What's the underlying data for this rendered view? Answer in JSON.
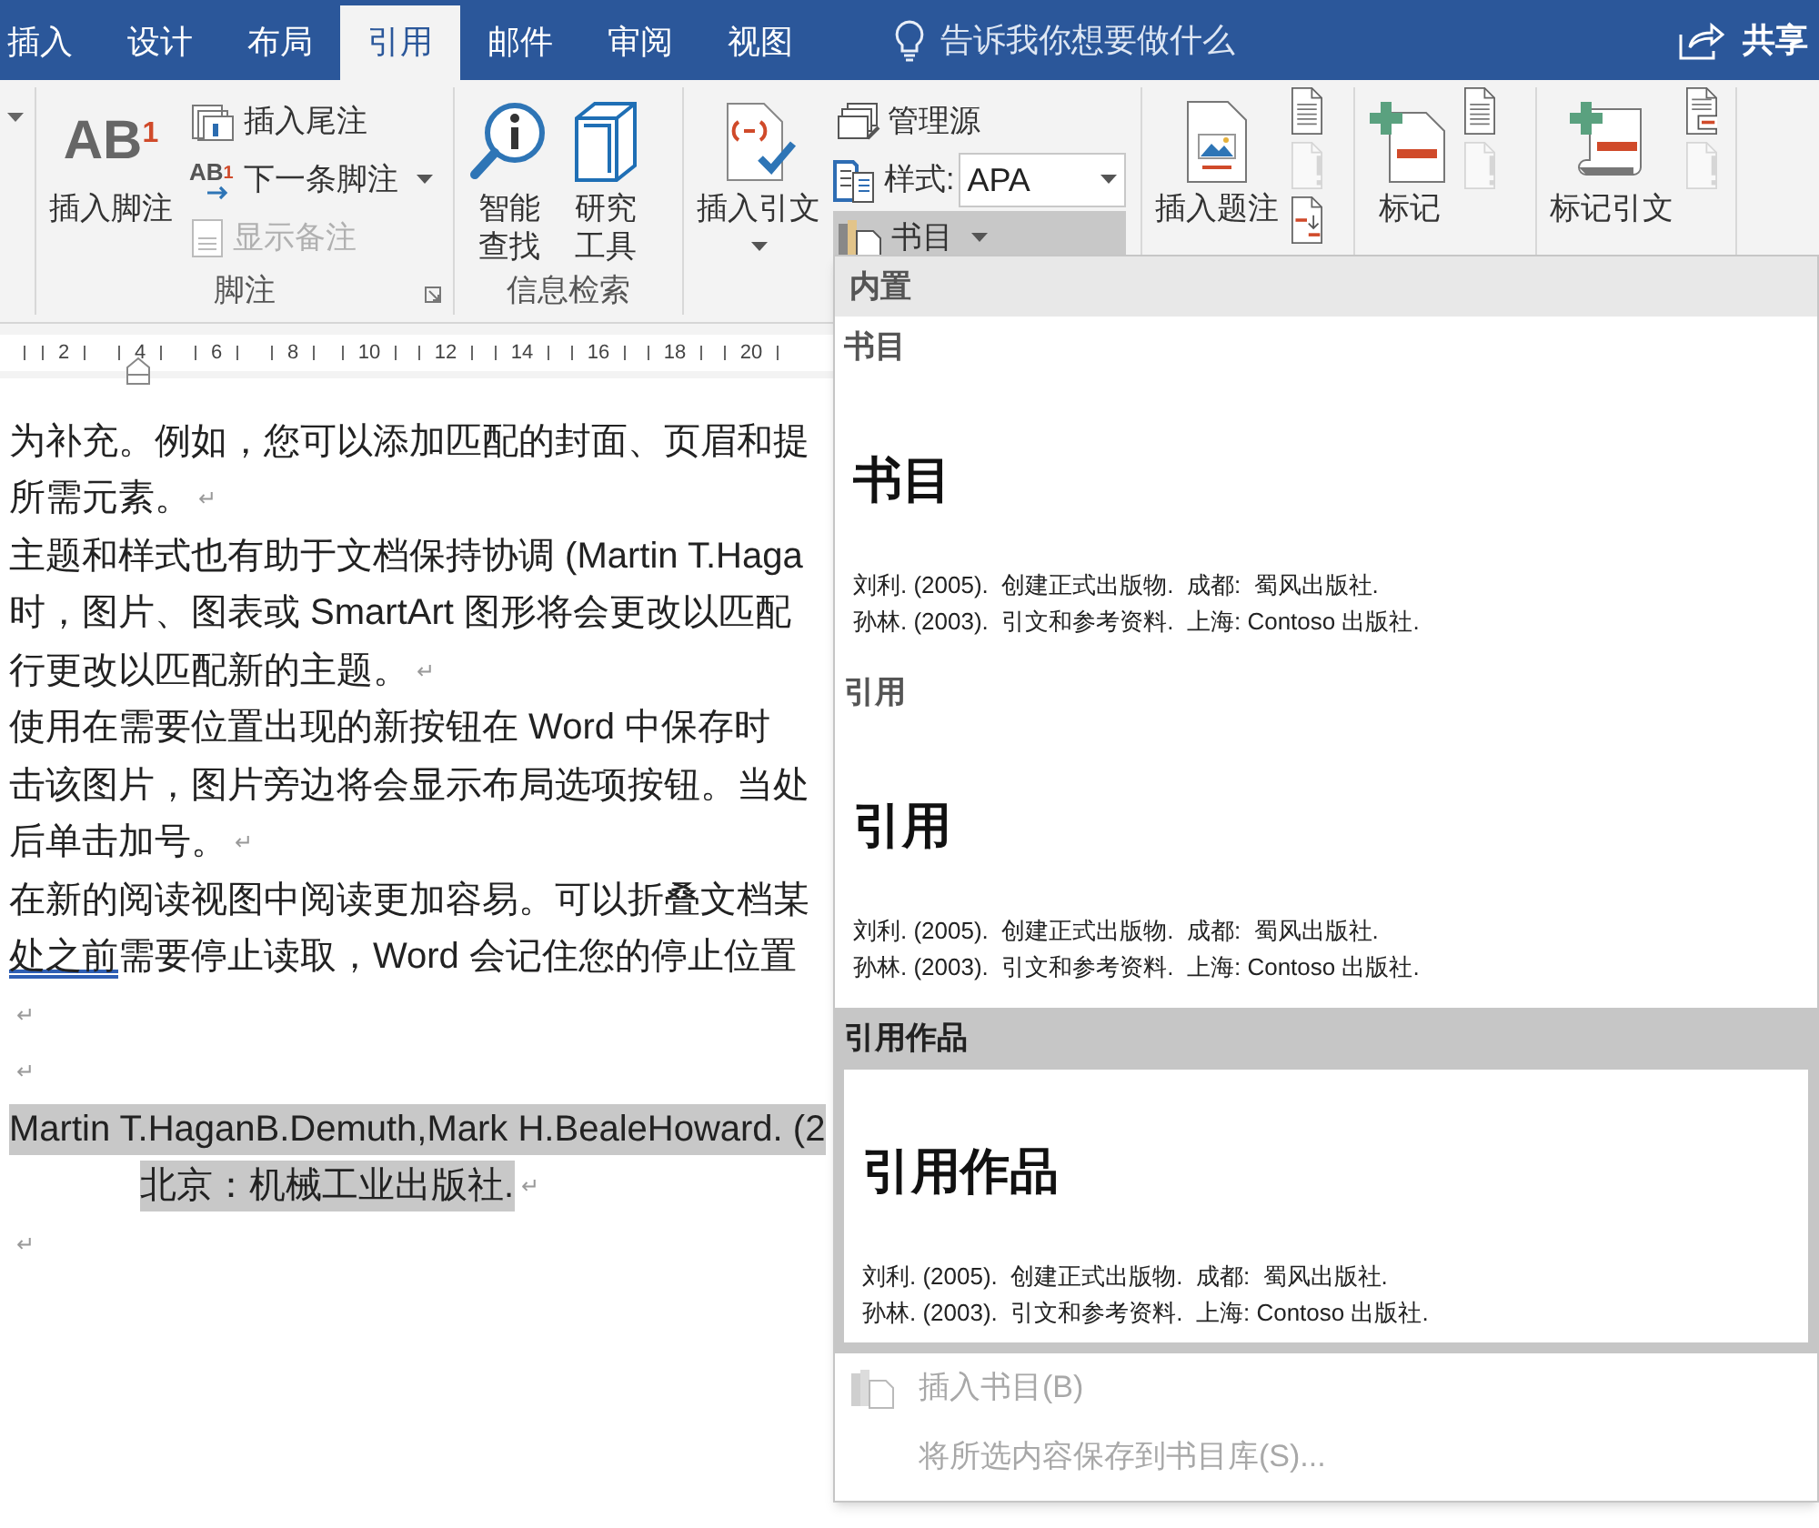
{
  "tabs": [
    {
      "label": "插入",
      "selected": false
    },
    {
      "label": "设计",
      "selected": false
    },
    {
      "label": "布局",
      "selected": false
    },
    {
      "label": "引用",
      "selected": true
    },
    {
      "label": "邮件",
      "selected": false
    },
    {
      "label": "审阅",
      "selected": false
    },
    {
      "label": "视图",
      "selected": false
    }
  ],
  "tell_me": {
    "placeholder": "告诉我你想要做什么"
  },
  "share_button": {
    "label": "共享"
  },
  "ribbon": {
    "groups": [
      {
        "items": [
          {
            "kind": "caret"
          }
        ]
      },
      {
        "label": "脚注",
        "launcher": true,
        "items": [
          {
            "kind": "large",
            "icon_text": "AB",
            "icon_sup": "1",
            "lines": [
              "插入脚注"
            ]
          },
          {
            "kind": "stack",
            "items": [
              {
                "kind": "button",
                "label": "插入尾注",
                "disabled": false
              },
              {
                "kind": "button",
                "label": "下一条脚注",
                "icon_text": "AB",
                "icon_sup": "1",
                "disabled": false,
                "caret": true
              },
              {
                "kind": "button",
                "label": "显示备注",
                "disabled": true
              }
            ]
          }
        ]
      },
      {
        "label": "信息检索",
        "items": [
          {
            "kind": "large",
            "lines": [
              "智能",
              "查找"
            ]
          },
          {
            "kind": "large",
            "lines": [
              "研究",
              "工具"
            ]
          }
        ]
      },
      {
        "items": [
          {
            "kind": "large",
            "lines": [
              "插入引文"
            ],
            "caret": true
          },
          {
            "kind": "stack",
            "items": [
              {
                "kind": "button",
                "label": "管理源",
                "pressed": false
              },
              {
                "kind": "select",
                "label": "样式:",
                "value": "APA"
              },
              {
                "kind": "button",
                "label": "书目",
                "pressed": true,
                "caret": true
              }
            ]
          }
        ]
      },
      {
        "items": [
          {
            "kind": "large",
            "lines": [
              "插入题注"
            ]
          },
          {
            "kind": "icons",
            "items": [
              {
                "disabled": false
              },
              {
                "disabled": true
              },
              {
                "disabled": false
              }
            ]
          }
        ]
      },
      {
        "items": [
          {
            "kind": "large",
            "lines": [
              "标记"
            ]
          },
          {
            "kind": "icons",
            "items": [
              {
                "disabled": false
              },
              {
                "disabled": true
              }
            ]
          }
        ]
      },
      {
        "items": [
          {
            "kind": "large",
            "lines": [
              "标记引文"
            ]
          },
          {
            "kind": "icons",
            "items": [
              {
                "disabled": false
              },
              {
                "disabled": true
              }
            ]
          }
        ]
      }
    ]
  },
  "document": {
    "ruler": [
      "2",
      "4",
      "6",
      "8",
      "10",
      "12",
      "14",
      "16",
      "18",
      "20"
    ],
    "lines": [
      {
        "text": "为补充。例如，您可以添加匹配的封面、页眉和提",
        "highlighted": false
      },
      {
        "text": "所需元素。",
        "mark": "↵",
        "highlighted": false
      },
      {
        "text": "主题和样式也有助于文档保持协调 (Martin T.Haga",
        "highlighted": false
      },
      {
        "text": "时，图片、图表或 SmartArt 图形将会更改以匹配",
        "highlighted": false
      },
      {
        "text": "行更改以匹配新的主题。",
        "mark": "↵",
        "highlighted": false
      },
      {
        "text": "使用在需要位置出现的新按钮在 Word 中保存时",
        "highlighted": false
      },
      {
        "text": "击该图片，图片旁边将会显示布局选项按钮。当处",
        "highlighted": false
      },
      {
        "text": "后单击加号。",
        "mark": "↵",
        "highlighted": false
      },
      {
        "text": "在新的阅读视图中阅读更加容易。可以折叠文档某",
        "highlighted": false
      },
      {
        "underlined": "处之前",
        "text": "需要停止读取，Word 会记住您的停止位置",
        "highlighted": false
      },
      {
        "mark": "↵"
      },
      {
        "mark": "↵"
      },
      {
        "text": "Martin T.HaganB.Demuth,Mark H.BealeHoward. (2",
        "highlighted": true
      },
      {
        "text": "北京：机械工业出版社.",
        "mark": "↵",
        "highlighted": true,
        "indent": true
      },
      {
        "mark": "↵"
      }
    ]
  },
  "bibliography_menu": {
    "section": "内置",
    "gallery": [
      {
        "label": "书目",
        "title": "书目",
        "entries": [
          "刘利. (2005).  创建正式出版物.  成都:  蜀风出版社.",
          "孙林. (2003).  引文和参考资料.  上海: Contoso 出版社."
        ],
        "selected": false
      },
      {
        "label": "引用",
        "title": "引用",
        "entries": [
          "刘利. (2005).  创建正式出版物.  成都:  蜀风出版社.",
          "孙林. (2003).  引文和参考资料.  上海: Contoso 出版社."
        ],
        "selected": false
      },
      {
        "label": "引用作品",
        "title": "引用作品",
        "entries": [
          "刘利. (2005).  创建正式出版物.  成都:  蜀风出版社.",
          "孙林. (2003).  引文和参考资料.  上海: Contoso 出版社."
        ],
        "selected": true
      }
    ],
    "commands": [
      {
        "label": "插入书目(B)",
        "disabled": true
      },
      {
        "label": "将所选内容保存到书目库(S)...",
        "disabled": true
      }
    ]
  }
}
